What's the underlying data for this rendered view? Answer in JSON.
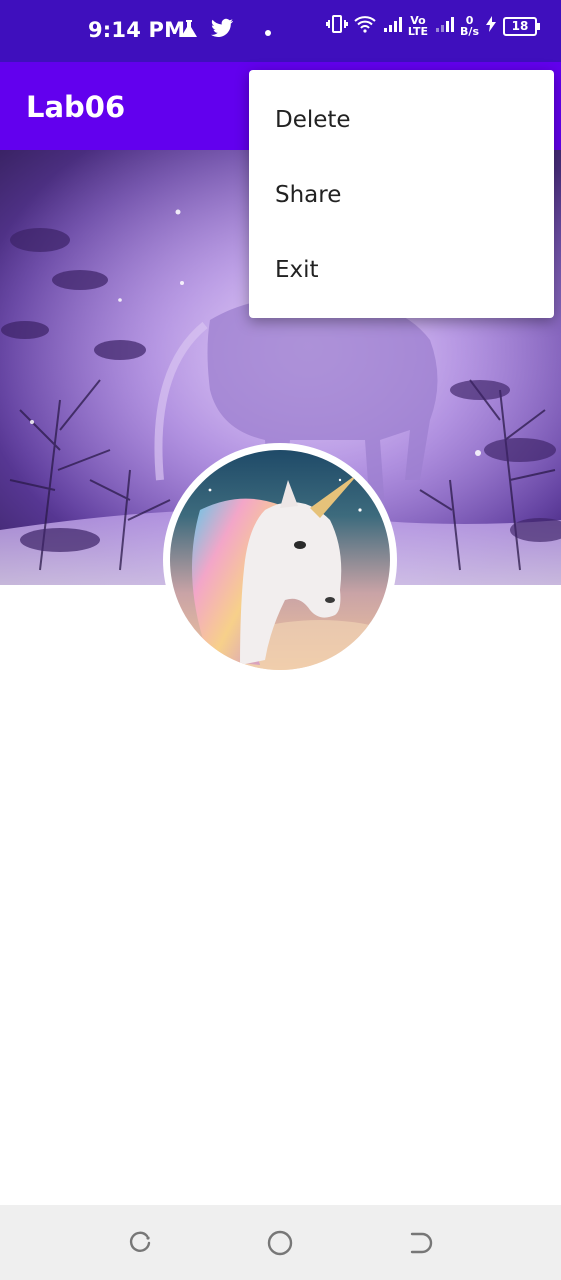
{
  "status_bar": {
    "time": "9:14 PM",
    "left_icons": [
      "flask-icon",
      "twitter-icon",
      "dot-icon"
    ],
    "right_icons": [
      "vibrate-icon",
      "wifi-icon",
      "signal-icon",
      "volte-icon",
      "signal-icon-2",
      "charging-icon"
    ],
    "volte_top": "Vo",
    "volte_bottom": "LTE",
    "net_speed_value": "0",
    "net_speed_unit": "B/s",
    "battery_level": "18"
  },
  "app_bar": {
    "title": "Lab06",
    "color": "#6200ee"
  },
  "overflow_menu": {
    "items": [
      {
        "label": "Delete"
      },
      {
        "label": "Share"
      },
      {
        "label": "Exit"
      }
    ]
  },
  "images": {
    "cover": "purple-forest-unicorn-cover-image",
    "avatar": "rainbow-unicorn-avatar"
  },
  "nav_bar": {
    "buttons": [
      "recents-icon",
      "home-icon",
      "back-icon"
    ]
  }
}
